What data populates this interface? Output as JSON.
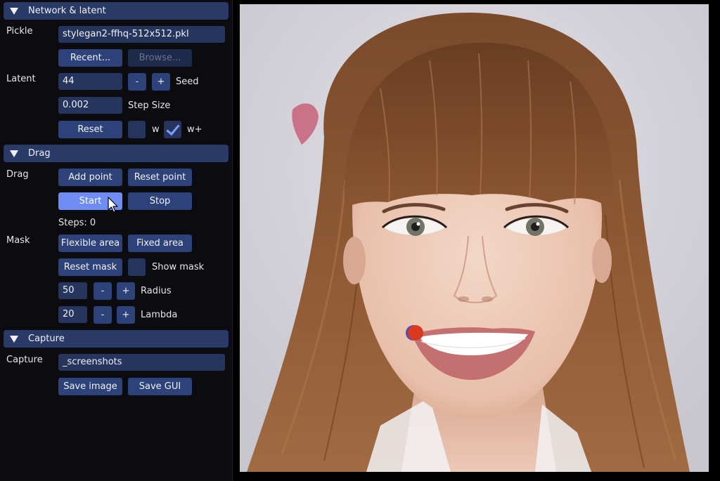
{
  "sections": {
    "network": {
      "title": "Network & latent"
    },
    "drag": {
      "title": "Drag"
    },
    "capture": {
      "title": "Capture"
    }
  },
  "network": {
    "pickle_label": "Pickle",
    "pickle_value": "stylegan2-ffhq-512x512.pkl",
    "recent_label": "Recent...",
    "browse_label": "Browse...",
    "latent_label": "Latent",
    "seed_value": "44",
    "minus": "-",
    "plus": "+",
    "seed_label": "Seed",
    "step_value": "0.002",
    "step_label": "Step Size",
    "reset_label": "Reset",
    "w_label": "w",
    "wplus_label": "w+",
    "w_checked": false,
    "wplus_checked": true
  },
  "drag": {
    "drag_label": "Drag",
    "add_point": "Add point",
    "reset_point": "Reset point",
    "start": "Start",
    "stop": "Stop",
    "steps": "Steps: 0",
    "mask_label": "Mask",
    "flexible_area": "Flexible area",
    "fixed_area": "Fixed area",
    "reset_mask": "Reset mask",
    "show_mask": "Show mask",
    "show_mask_checked": false,
    "radius_value": "50",
    "radius_label": "Radius",
    "lambda_value": "20",
    "lambda_label": "Lambda",
    "minus": "-",
    "plus": "+"
  },
  "capture": {
    "capture_label": "Capture",
    "dir_value": "_screenshots",
    "save_image": "Save image",
    "save_gui": "Save GUI"
  },
  "colors": {
    "panel_bg": "#0b0b10",
    "header": "#2a3a66",
    "button": "#2d4278",
    "button_active": "#6f8cf3",
    "field": "#25355e",
    "drag_point": "#d93a1e"
  }
}
